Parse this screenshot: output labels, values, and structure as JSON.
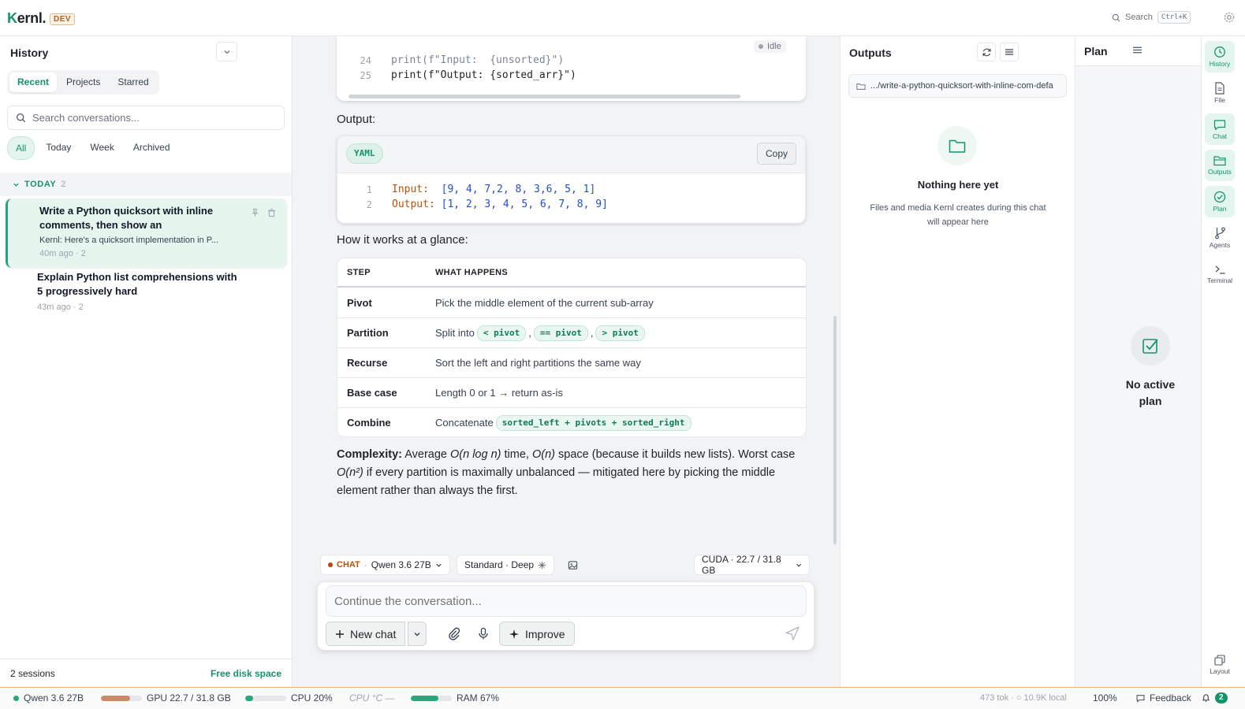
{
  "app": {
    "logo_k": "K",
    "logo_rest": "ernl.",
    "env_badge": "DEV"
  },
  "topbar": {
    "search_label": "Search",
    "search_shortcut": "Ctrl+K"
  },
  "sidebar": {
    "title": "History",
    "tabs": [
      "Recent",
      "Projects",
      "Starred"
    ],
    "active_tab": "Recent",
    "search_placeholder": "Search conversations...",
    "filters": [
      "All",
      "Today",
      "Week",
      "Archived"
    ],
    "active_filter": "All",
    "group_label": "TODAY",
    "group_count": "2",
    "conversations": [
      {
        "title": "Write a Python quicksort with inline comments, then show an",
        "preview": "Kernl: Here's a quicksort implementation in P...",
        "meta": "40m ago · 2"
      },
      {
        "title": "Explain Python list comprehensions with 5 progressively hard",
        "preview": "",
        "meta": "43m ago · 2"
      }
    ],
    "footer_sessions": "2 sessions",
    "footer_action": "Free disk space"
  },
  "main": {
    "status": "Idle",
    "code_lines": [
      {
        "n": "24",
        "code": "print(f\"Input:  {unsorted}\")"
      },
      {
        "n": "25",
        "code": "print(f\"Output: {sorted_arr}\")"
      }
    ],
    "output_label": "Output:",
    "yaml_badge": "YAML",
    "copy_label": "Copy",
    "yaml_lines": [
      {
        "n": "1",
        "key": "Input:",
        "val": "  [9, 4, 7,2, 8, 3,6, 5, 1]"
      },
      {
        "n": "2",
        "key": "Output:",
        "val": " [1, 2, 3, 4, 5, 6, 7, 8, 9]"
      }
    ],
    "how_label": "How it works at a glance:",
    "table": {
      "headers": [
        "STEP",
        "WHAT HAPPENS"
      ],
      "rows": [
        {
          "step": "Pivot",
          "text": "Pick the middle element of the current sub-array",
          "pills": []
        },
        {
          "step": "Partition",
          "text": "Split into",
          "pills": [
            "< pivot",
            "== pivot",
            "> pivot"
          ]
        },
        {
          "step": "Recurse",
          "text": "Sort the left and right partitions the same way",
          "pills": []
        },
        {
          "step": "Base case",
          "text": "Length 0 or 1 → return as-is",
          "pills": []
        },
        {
          "step": "Combine",
          "text": "Concatenate",
          "pills": [
            "sorted_left + pivots + sorted_right"
          ]
        }
      ]
    },
    "complexity": {
      "label": "Complexity:",
      "t1": " Average ",
      "avg": "O(n log n)",
      "t2": " time, ",
      "space": "O(n)",
      "t3": " space (because it builds new lists). Worst case ",
      "worst": "O(n²)",
      "t4": " if every partition is maximally unbalanced — mitigated here by picking the middle element rather than always the first."
    }
  },
  "composer": {
    "mode": "CHAT",
    "model": "Qwen 3.6 27B",
    "depth": "Standard · Deep",
    "cuda": "CUDA · 22.7 / 31.8 GB",
    "placeholder": "Continue the conversation...",
    "new_chat_label": "New chat",
    "improve_label": "Improve"
  },
  "outputs": {
    "title": "Outputs",
    "path": ".../write-a-python-quicksort-with-inline-com-defa",
    "empty_title": "Nothing here yet",
    "empty_desc": "Files and media Kernl creates during this chat will appear here"
  },
  "plan": {
    "title": "Plan",
    "empty_text": "No active plan"
  },
  "rail": [
    "History",
    "File",
    "Chat",
    "Outputs",
    "Plan",
    "Agents",
    "Terminal",
    "Layout"
  ],
  "rail_active": [
    "History",
    "Chat",
    "Outputs",
    "Plan"
  ],
  "statusbar": {
    "model": "Qwen 3.6 27B",
    "gpu": "GPU 22.7 / 31.8 GB",
    "gpu_fill": 0.71,
    "cpu": "CPU 20%",
    "cpu_fill": 0.2,
    "cpu_temp": "CPU °C —",
    "ram": "RAM 67%",
    "ram_fill": 0.67,
    "tokens": "473 tok · ○ 10.9K local",
    "zoom": "100%",
    "feedback": "Feedback",
    "notifications": "2",
    "colors": {
      "gpu": "#c98b6a",
      "cpu": "#2aa77a",
      "ram": "#2aa77a",
      "accent": "#14946b"
    }
  }
}
